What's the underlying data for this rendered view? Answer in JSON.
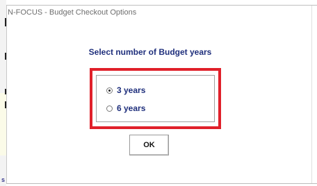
{
  "dialog": {
    "title": "N-FOCUS - Budget Checkout Options",
    "prompt": "Select number of Budget years",
    "options": [
      {
        "label": "3 years",
        "selected": true
      },
      {
        "label": "6 years",
        "selected": false
      }
    ],
    "ok_label": "OK"
  },
  "background": {
    "edge_letter": "s"
  },
  "colors": {
    "highlight": "#e0202a",
    "label_text": "#1f2f7c",
    "title_text": "#6e6e6e"
  }
}
